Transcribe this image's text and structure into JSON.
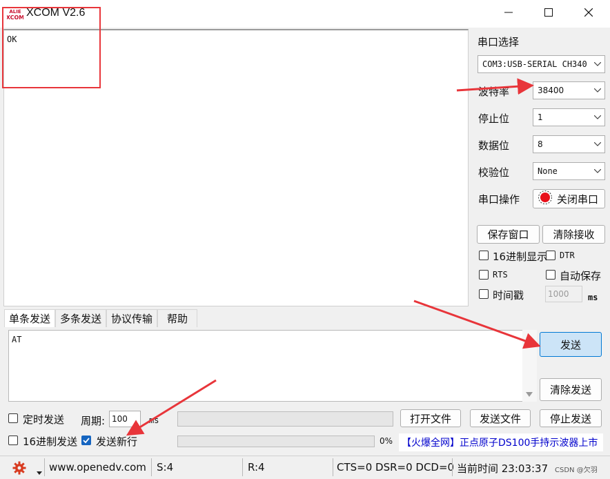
{
  "window": {
    "title": "XCOM V2.6",
    "logo_text": "XCOM"
  },
  "receive": {
    "text": "OK"
  },
  "serial": {
    "section_title": "串口选择",
    "port_value": "COM3:USB-SERIAL CH340",
    "baud_label": "波特率",
    "baud_value": "38400",
    "stopbits_label": "停止位",
    "stopbits_value": "1",
    "databits_label": "数据位",
    "databits_value": "8",
    "parity_label": "校验位",
    "parity_value": "None",
    "operation_label": "串口操作",
    "close_port_label": "关闭串口",
    "save_window_label": "保存窗口",
    "clear_receive_label": "清除接收",
    "hex_display_label": "16进制显示",
    "dtr_label": "DTR",
    "rts_label": "RTS",
    "auto_save_label": "自动保存",
    "timestamp_label": "时间戳",
    "timestamp_value": "1000",
    "timestamp_unit": "ms"
  },
  "tabs": [
    {
      "label": "单条发送",
      "active": true
    },
    {
      "label": "多条发送",
      "active": false
    },
    {
      "label": "协议传输",
      "active": false
    },
    {
      "label": "帮助",
      "active": false
    }
  ],
  "send": {
    "text": "AT",
    "send_label": "发送",
    "clear_send_label": "清除发送",
    "timed_send_label": "定时发送",
    "period_label": "周期:",
    "period_value": "100",
    "period_unit": "ms",
    "open_file_label": "打开文件",
    "send_file_label": "发送文件",
    "stop_send_label": "停止发送",
    "hex_send_label": "16进制发送",
    "send_newline_label": "发送新行",
    "newline_checked": true,
    "progress_text": "0%",
    "progress_value": 0,
    "ad_text": "【火爆全网】正点原子DS100手持示波器上市"
  },
  "status": {
    "website": "www.openedv.com",
    "sent": "S:4",
    "received": "R:4",
    "lines": "CTS=0 DSR=0 DCD=0",
    "time": "当前时间 23:03:37",
    "watermark": "CSDN @欠羽"
  },
  "colors": {
    "accent_red": "#e8353a",
    "send_button": "#cce4f7",
    "checkbox_blue": "#1665c0",
    "ad_blue": "#0000cc"
  }
}
